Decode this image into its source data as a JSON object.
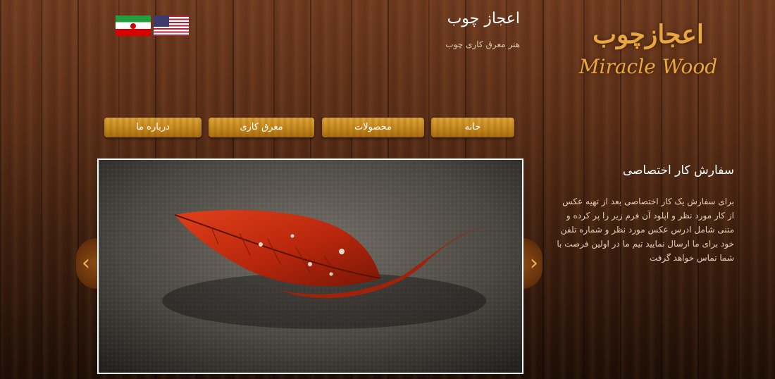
{
  "header": {
    "site_title": "اعجاز چوب",
    "site_subtitle": "هنر معرق کاری چوب",
    "logo_fa": "اعجازچوب",
    "logo_en": "Miracle Wood"
  },
  "languages": [
    {
      "name": "iran-flag-icon",
      "label": "فارسی"
    },
    {
      "name": "us-flag-icon",
      "label": "English"
    }
  ],
  "nav": {
    "items": [
      {
        "label": "خانه"
      },
      {
        "label": "محصولات"
      },
      {
        "label": "معرق کاری"
      },
      {
        "label": "درباره ما"
      }
    ]
  },
  "slider": {
    "prev_icon": "chevron-left-icon",
    "next_icon": "chevron-right-icon"
  },
  "sidebar": {
    "title": "سفارش کار اختصاصی",
    "text": "برای سفارش یک کار اختصاصی بعد از تهیه عکس از کار مورد نظر و اپلود آن فرم زیر را پر کرده و متنی شامل ادرس عکس مورد نظر و شماره تلفن خود برای ما ارسال نمایید تیم ما در اولین فرصت با شما تماس خواهد گرفت"
  },
  "colors": {
    "accent_gold": "#c98b1e",
    "wood_dark": "#3e1f0f",
    "logo_gold": "#e8a640"
  }
}
